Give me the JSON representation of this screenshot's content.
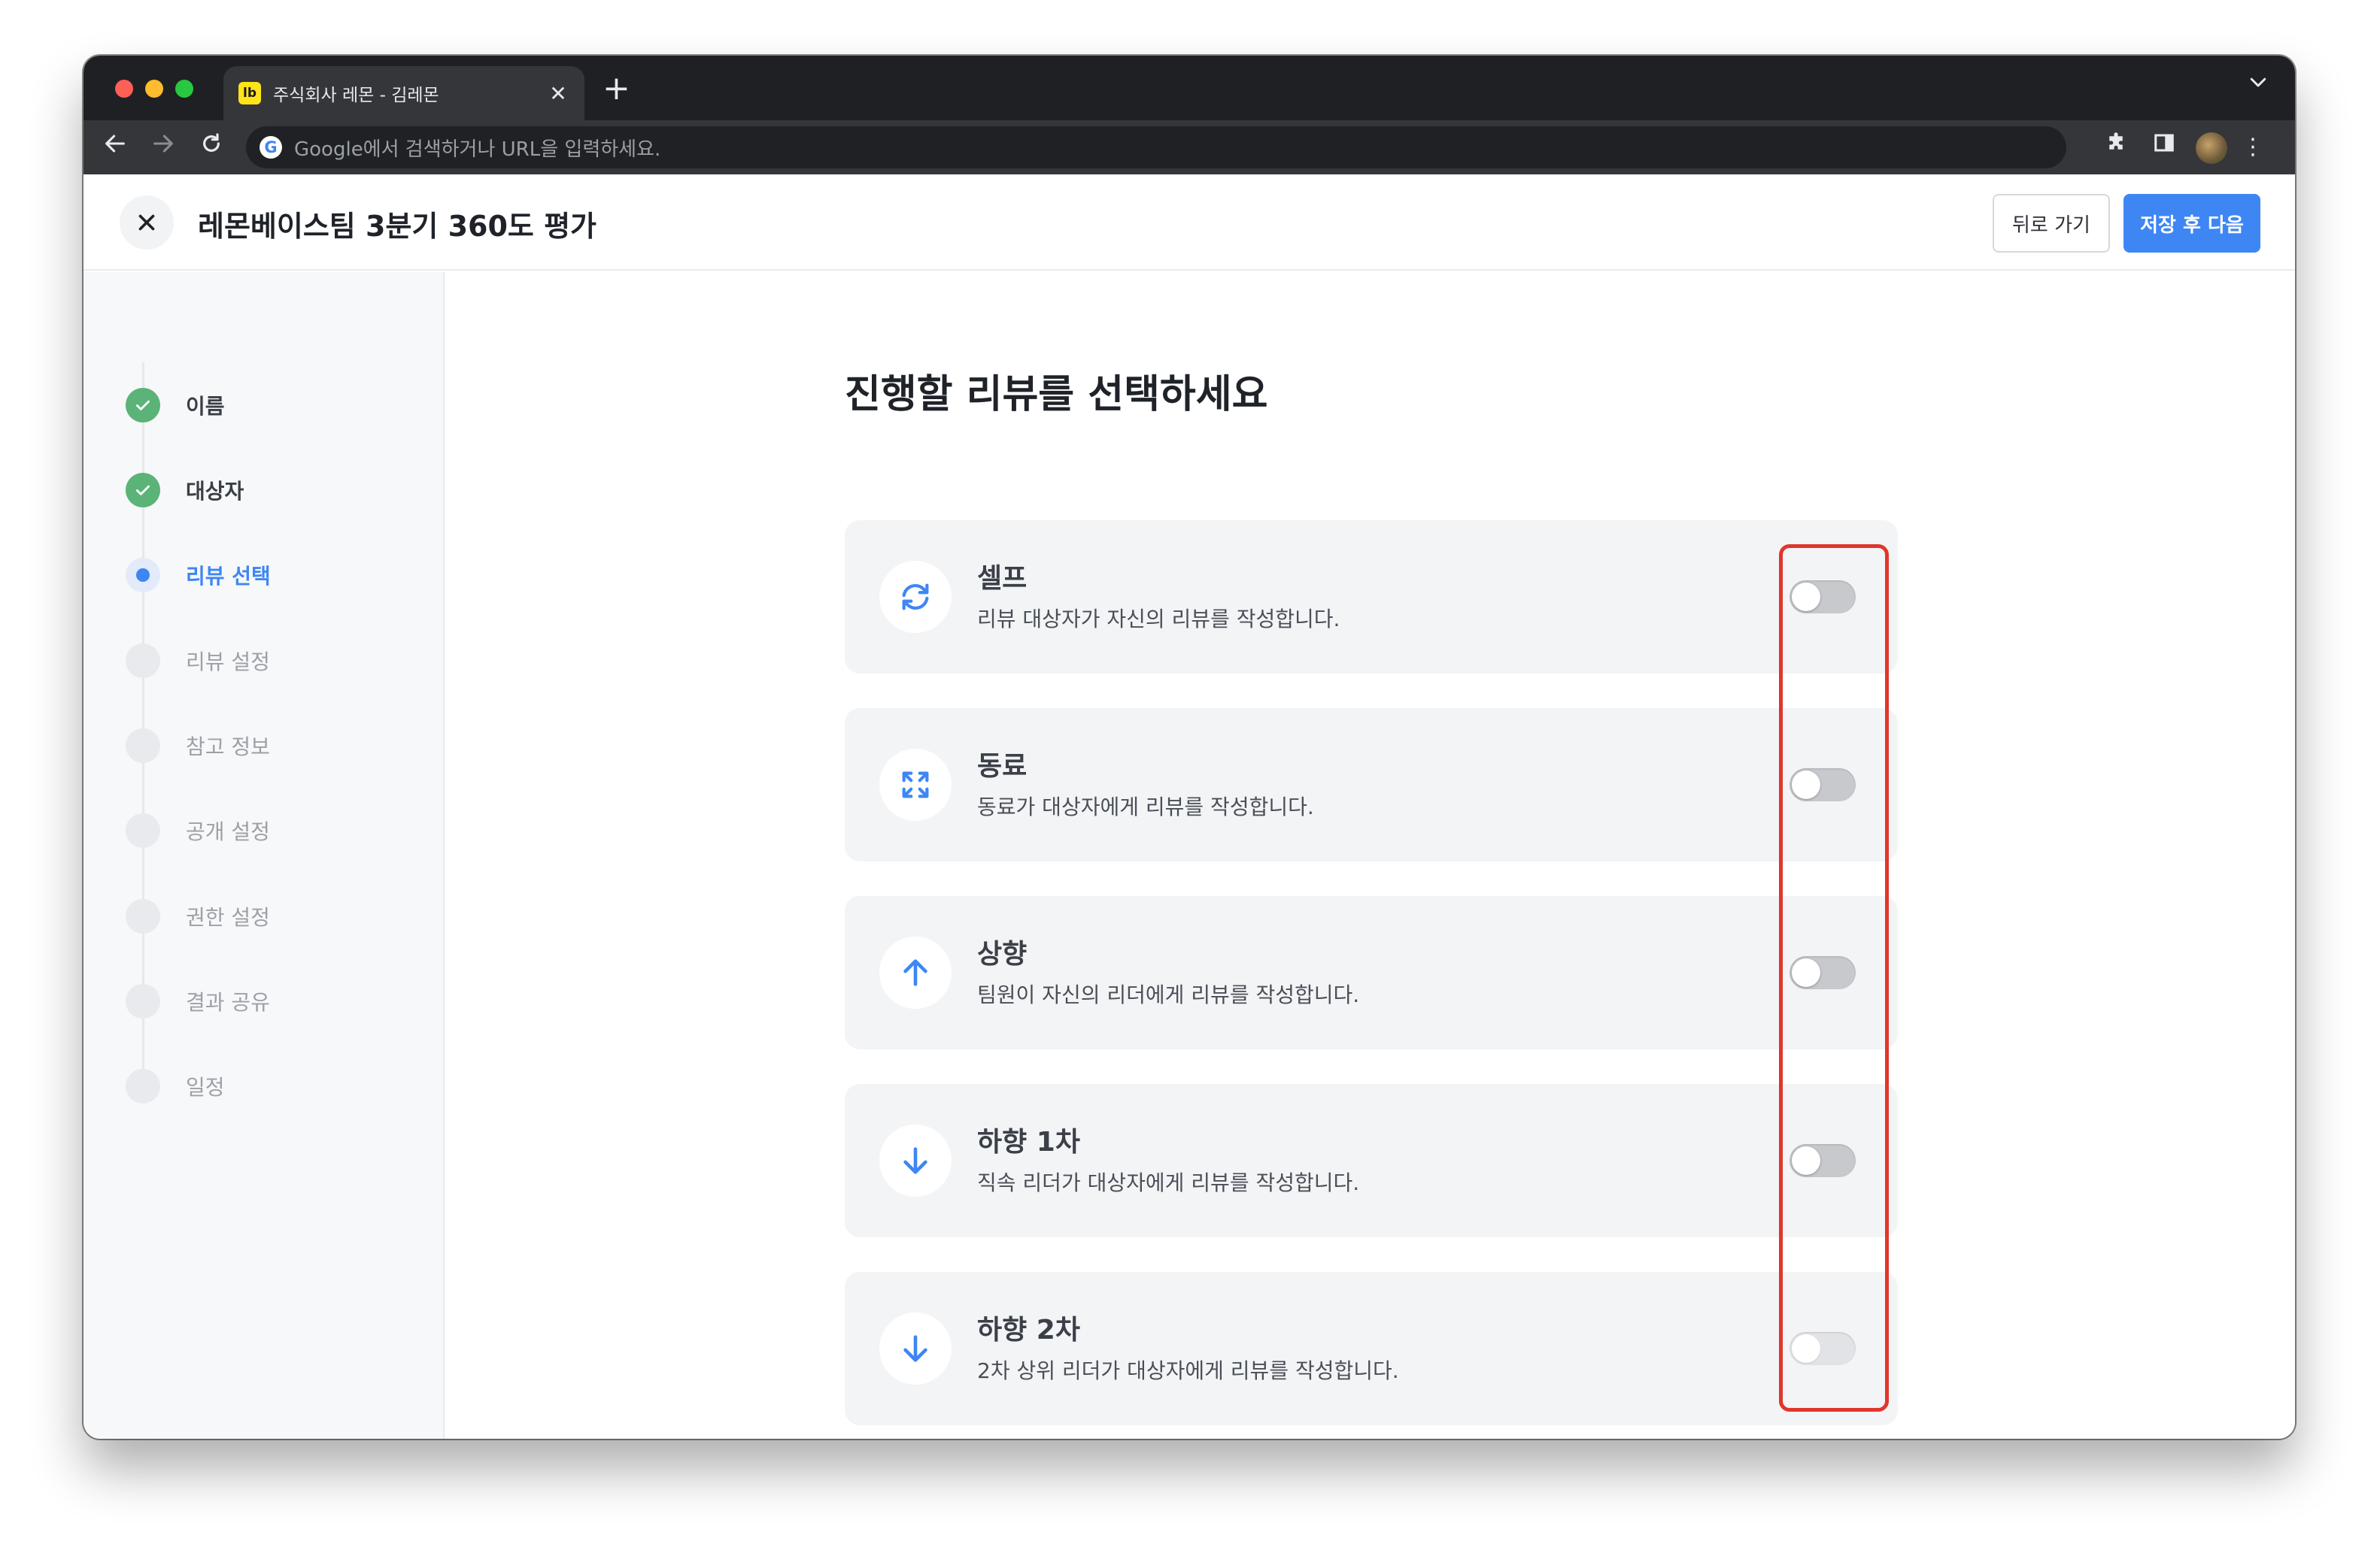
{
  "browser": {
    "tab": {
      "favicon_text": "lb",
      "title": "주식회사 레몬 - 김레몬",
      "close": "✕"
    },
    "new_tab": "+",
    "tab_dropdown": "⌄",
    "nav": {
      "back": "←",
      "forward": "→",
      "reload": "↻"
    },
    "omnibox": {
      "g_logo": "G",
      "placeholder": "Google에서 검색하거나 URL을 입력하세요."
    },
    "icons": {
      "extensions": "puzzle-icon",
      "side_panel": "side-panel-icon",
      "menu": "⋮"
    }
  },
  "header": {
    "title": "레몬베이스팀 3분기 360도 평가",
    "back_button": "뒤로 가기",
    "next_button": "저장 후 다음"
  },
  "sidebar": {
    "steps": [
      {
        "label": "이름",
        "status": "done"
      },
      {
        "label": "대상자",
        "status": "done"
      },
      {
        "label": "리뷰 선택",
        "status": "active"
      },
      {
        "label": "리뷰 설정",
        "status": "pending"
      },
      {
        "label": "참고 정보",
        "status": "pending"
      },
      {
        "label": "공개 설정",
        "status": "pending"
      },
      {
        "label": "권한 설정",
        "status": "pending"
      },
      {
        "label": "결과 공유",
        "status": "pending"
      },
      {
        "label": "일정",
        "status": "pending"
      }
    ]
  },
  "main": {
    "heading": "진행할 리뷰를 선택하세요",
    "cards": [
      {
        "icon": "refresh-icon",
        "title": "셀프",
        "desc": "리뷰 대상자가 자신의 리뷰를 작성합니다.",
        "enabled": false,
        "disabled": false
      },
      {
        "icon": "expand-icon",
        "title": "동료",
        "desc": "동료가 대상자에게 리뷰를 작성합니다.",
        "enabled": false,
        "disabled": false
      },
      {
        "icon": "arrow-up-icon",
        "title": "상향",
        "desc": "팀원이 자신의 리더에게 리뷰를 작성합니다.",
        "enabled": false,
        "disabled": false
      },
      {
        "icon": "arrow-down-icon",
        "title": "하향 1차",
        "desc": "직속 리더가 대상자에게 리뷰를 작성합니다.",
        "enabled": false,
        "disabled": false
      },
      {
        "icon": "arrow-down-icon",
        "title": "하향 2차",
        "desc": "2차 상위 리더가 대상자에게 리뷰를 작성합니다.",
        "enabled": false,
        "disabled": true
      }
    ]
  },
  "help": {
    "label": "?"
  },
  "colors": {
    "accent": "#3e86f4",
    "done": "#5bb377",
    "highlight": "#e0362b",
    "help": "#1e6fd9"
  }
}
